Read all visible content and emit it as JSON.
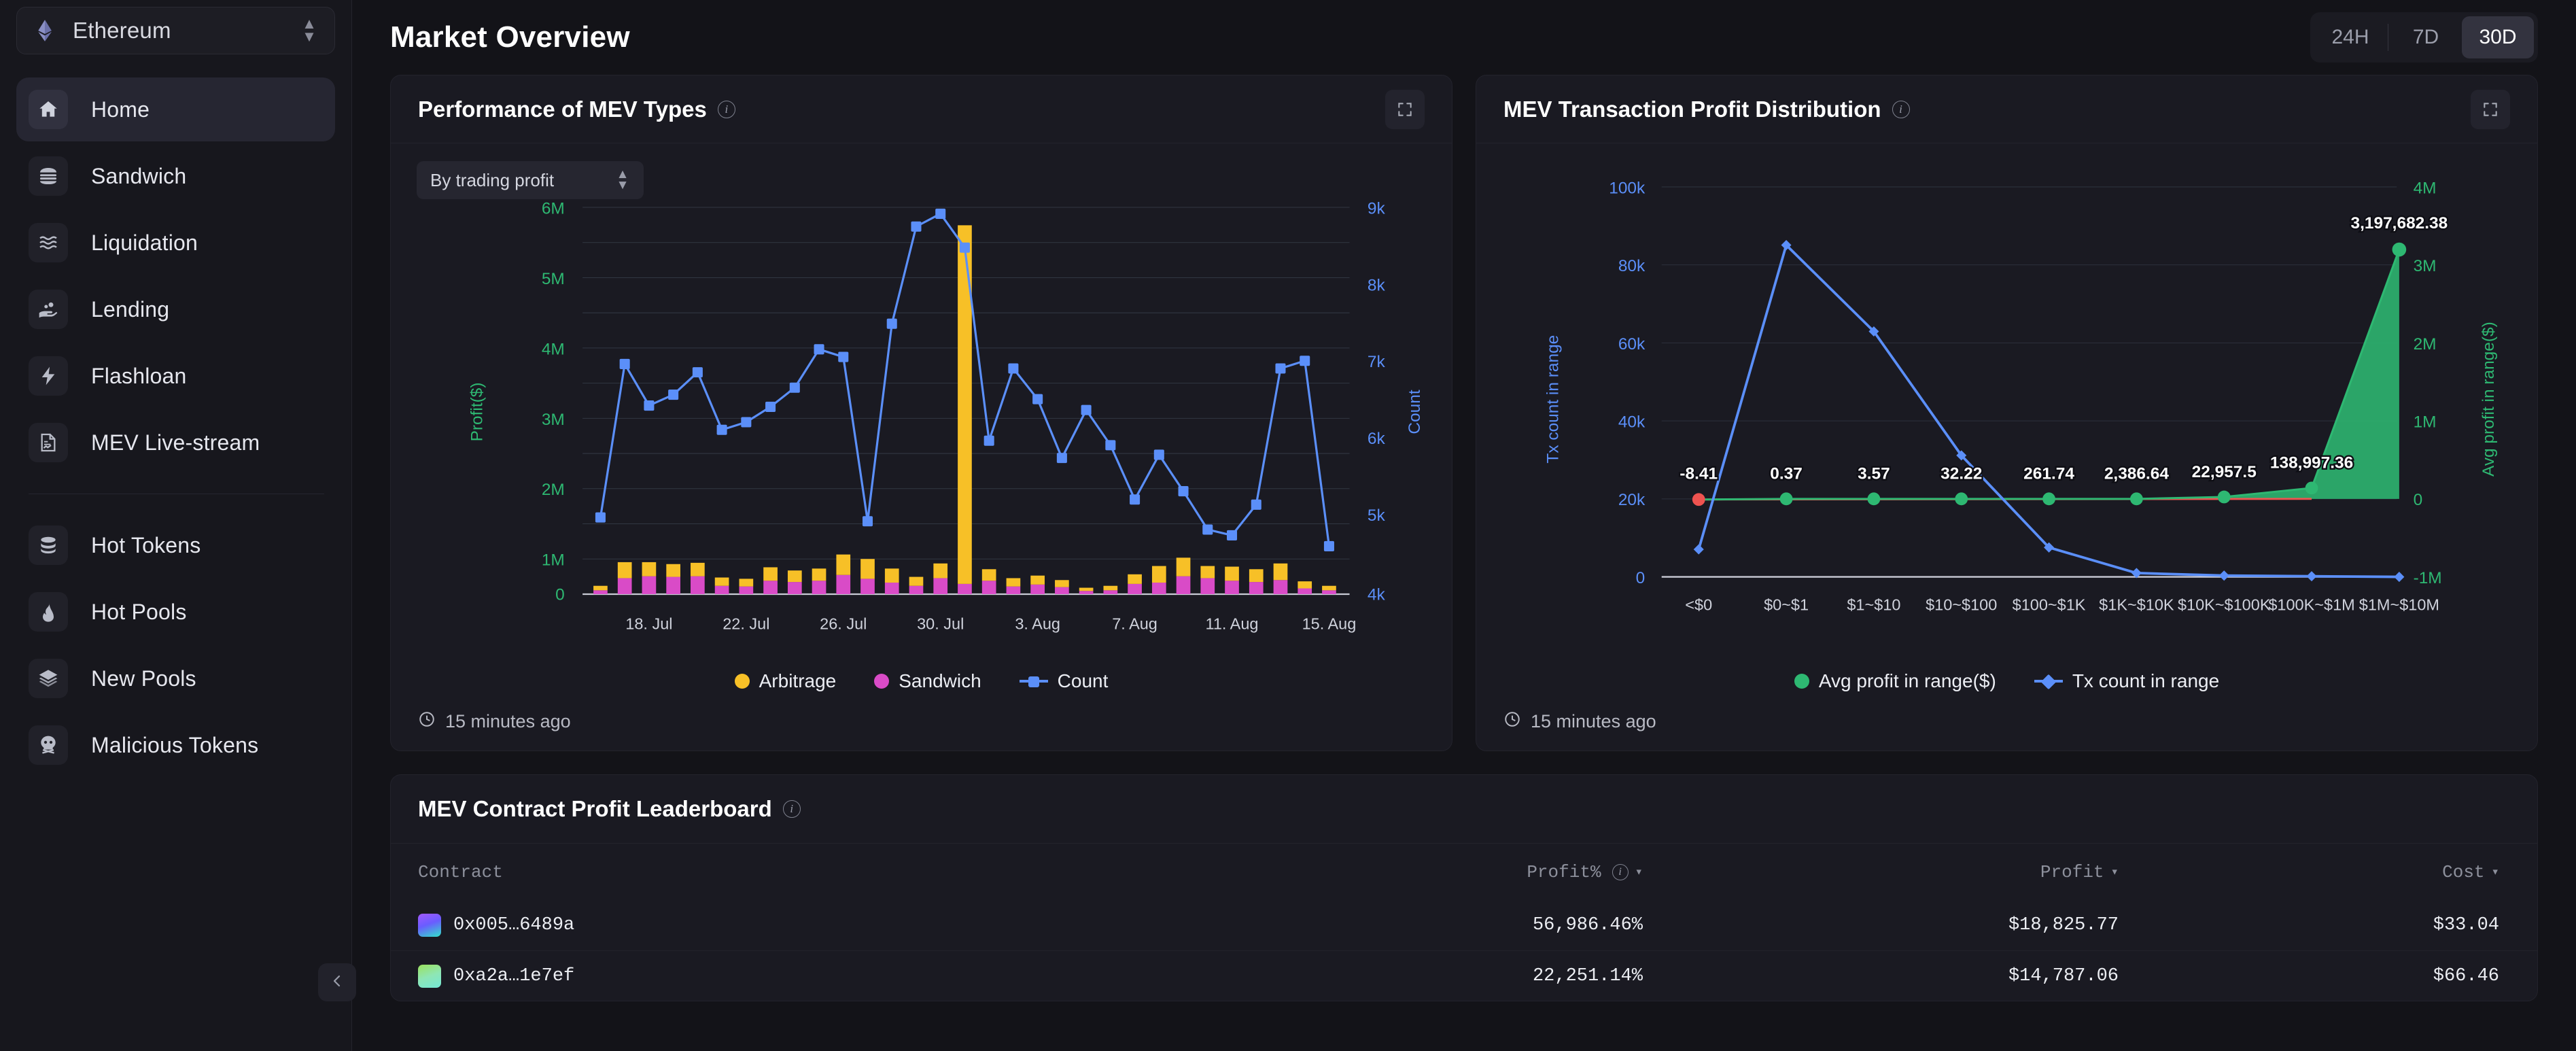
{
  "sidebar": {
    "chain": {
      "name": "Ethereum",
      "icon": "ethereum-icon",
      "chevron": "chevron-updown-icon"
    },
    "items": [
      {
        "label": "Home",
        "icon": "home-icon",
        "active": true
      },
      {
        "label": "Sandwich",
        "icon": "sandwich-icon",
        "active": false
      },
      {
        "label": "Liquidation",
        "icon": "liquidation-icon",
        "active": false
      },
      {
        "label": "Lending",
        "icon": "lending-icon",
        "active": false
      },
      {
        "label": "Flashloan",
        "icon": "flashloan-icon",
        "active": false
      },
      {
        "label": "MEV Live-stream",
        "icon": "livestream-icon",
        "active": false
      }
    ],
    "items2": [
      {
        "label": "Hot Tokens",
        "icon": "database-icon"
      },
      {
        "label": "Hot Pools",
        "icon": "flame-icon"
      },
      {
        "label": "New Pools",
        "icon": "layers-icon"
      },
      {
        "label": "Malicious Tokens",
        "icon": "skull-icon"
      }
    ],
    "collapse_icon": "chevron-left-icon"
  },
  "header": {
    "title": "Market Overview",
    "ranges": [
      {
        "label": "24H",
        "active": false
      },
      {
        "label": "7D",
        "active": false
      },
      {
        "label": "30D",
        "active": true
      }
    ]
  },
  "left_card": {
    "title": "Performance of MEV Types",
    "info_icon": "info-icon",
    "expand_icon": "expand-icon",
    "select_value": "By trading profit",
    "select_chevron": "chevron-updown-icon",
    "updated": "15 minutes ago",
    "clock_icon": "clock-icon",
    "legend": [
      {
        "label": "Arbitrage",
        "color": "#f7c027",
        "shape": "dot"
      },
      {
        "label": "Sandwich",
        "color": "#d94bc7",
        "shape": "dot"
      },
      {
        "label": "Count",
        "color": "#5b8ff9",
        "shape": "line-square"
      }
    ]
  },
  "right_card": {
    "title": "MEV Transaction Profit Distribution",
    "info_icon": "info-icon",
    "expand_icon": "expand-icon",
    "updated": "15 minutes ago",
    "clock_icon": "clock-icon",
    "legend": [
      {
        "label": "Avg profit in range($)",
        "color": "#2eb872",
        "shape": "dot"
      },
      {
        "label": "Tx count in range",
        "color": "#5b8ff9",
        "shape": "line-diamond"
      }
    ]
  },
  "leaderboard": {
    "title": "MEV Contract Profit Leaderboard",
    "info_icon": "info-icon",
    "columns": [
      {
        "label": "Contract",
        "sortable": false
      },
      {
        "label": "Profit%",
        "sortable": true,
        "info_icon": "info-icon",
        "caret": "▾"
      },
      {
        "label": "Profit",
        "sortable": true,
        "caret": "▾"
      },
      {
        "label": "Cost",
        "sortable": true,
        "caret": "▾"
      }
    ],
    "rows": [
      {
        "contract": "0x005…6489a",
        "profit_pct": "56,986.46%",
        "profit": "$18,825.77",
        "cost": "$33.04",
        "avatar_from": "#a259ff",
        "avatar_to": "#30e3ca"
      },
      {
        "contract": "0xa2a…1e7ef",
        "profit_pct": "22,251.14%",
        "profit": "$14,787.06",
        "cost": "$66.46",
        "avatar_from": "#9be15d",
        "avatar_to": "#74e8d6"
      }
    ]
  },
  "colors": {
    "page_bg": "#131318",
    "card_bg": "#1a1a22",
    "sidebar_bg": "#17171d",
    "arbitrage": "#f7c027",
    "sandwich": "#d94bc7",
    "count_line": "#5b8ff9",
    "profit_axis": "#2eb872",
    "negative_point": "#ef5350"
  },
  "chart_data": [
    {
      "type": "bar",
      "title": "Performance of MEV Types",
      "xlabel": "",
      "ylabel": "Profit($)",
      "y2label": "Count",
      "ylim": [
        0,
        6000000
      ],
      "y2lim": [
        4000,
        9000
      ],
      "ytick_labels": [
        "0",
        "1M",
        "2M",
        "3M",
        "4M",
        "5M",
        "6M"
      ],
      "y2tick_labels": [
        "4k",
        "5k",
        "6k",
        "7k",
        "8k",
        "9k"
      ],
      "xtick_labels": [
        "18. Jul",
        "22. Jul",
        "26. Jul",
        "30. Jul",
        "3. Aug",
        "7. Aug",
        "11. Aug",
        "15. Aug"
      ],
      "categories": [
        "16. Jul",
        "17. Jul",
        "18. Jul",
        "19. Jul",
        "20. Jul",
        "21. Jul",
        "22. Jul",
        "23. Jul",
        "24. Jul",
        "25. Jul",
        "26. Jul",
        "27. Jul",
        "28. Jul",
        "29. Jul",
        "30. Jul",
        "31. Jul",
        "1. Aug",
        "2. Aug",
        "3. Aug",
        "4. Aug",
        "5. Aug",
        "6. Aug",
        "7. Aug",
        "8. Aug",
        "9. Aug",
        "10. Aug",
        "11. Aug",
        "12. Aug",
        "13. Aug",
        "14. Aug",
        "15. Aug"
      ],
      "series": [
        {
          "name": "Arbitrage",
          "type": "bar-stack",
          "color": "#f7c027",
          "values": [
            60000,
            210000,
            185000,
            170000,
            175000,
            110000,
            105000,
            180000,
            150000,
            160000,
            270000,
            265000,
            185000,
            120000,
            190000,
            4800000,
            150000,
            105000,
            120000,
            90000,
            45000,
            60000,
            130000,
            215000,
            240000,
            160000,
            180000,
            165000,
            220000,
            95000,
            60000
          ]
        },
        {
          "name": "Sandwich",
          "type": "bar-stack",
          "color": "#d94bc7",
          "values": [
            18000,
            85000,
            95000,
            90000,
            95000,
            40000,
            35000,
            70000,
            65000,
            70000,
            100000,
            80000,
            60000,
            45000,
            85000,
            55000,
            70000,
            40000,
            50000,
            35000,
            15000,
            20000,
            55000,
            60000,
            95000,
            85000,
            70000,
            65000,
            75000,
            30000,
            20000
          ]
        },
        {
          "name": "Count",
          "type": "line",
          "axis": "y2",
          "color": "#5b8ff9",
          "values": [
            5000,
            7000,
            5450,
            5600,
            5950,
            5200,
            5300,
            5500,
            5750,
            6250,
            6100,
            4950,
            6800,
            8000,
            8200,
            7750,
            8450,
            8000,
            6100,
            6950,
            6500,
            5750,
            6450,
            5550,
            6650,
            5900,
            5200,
            5100,
            5450,
            7200,
            7300,
            4600
          ]
        }
      ]
    },
    {
      "type": "line",
      "title": "MEV Transaction Profit Distribution",
      "xlabel": "",
      "ylabel": "Tx count in range",
      "y2label": "Avg profit in range($)",
      "ylim": [
        0,
        100000
      ],
      "y2lim": [
        -1000000,
        4000000
      ],
      "ytick_labels": [
        "0",
        "20k",
        "40k",
        "60k",
        "80k",
        "100k"
      ],
      "y2tick_labels": [
        "-1M",
        "0",
        "1M",
        "2M",
        "3M",
        "4M"
      ],
      "categories": [
        "<$0",
        "$0~$1",
        "$1~$10",
        "$10~$100",
        "$100~$1K",
        "$1K~$10K",
        "$10K~$100K",
        "$100K~$1M",
        "$1M~$10M"
      ],
      "series": [
        {
          "name": "Tx count in range",
          "color": "#5b8ff9",
          "axis": "y1",
          "values": [
            7000,
            85000,
            63000,
            31000,
            7500,
            900,
            400,
            300,
            250
          ]
        },
        {
          "name": "Avg profit in range($)",
          "color": "#2eb872",
          "axis": "y2",
          "area": true,
          "values": [
            -8.41,
            0.37,
            3.57,
            32.22,
            261.74,
            2386.64,
            22957.5,
            138997.36,
            3197682.38
          ],
          "labels": [
            "-8.41",
            "0.37",
            "3.57",
            "32.22",
            "261.74",
            "2,386.64",
            "22,957.5",
            "138,997.36",
            "3,197,682.38"
          ]
        }
      ]
    }
  ]
}
